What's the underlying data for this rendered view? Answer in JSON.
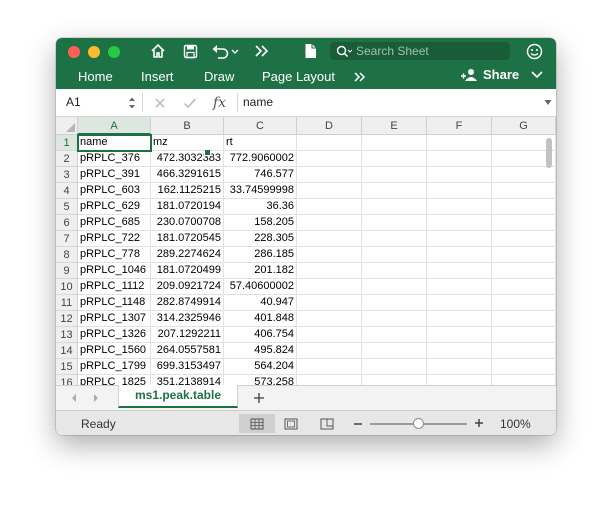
{
  "colors": {
    "ribbon": "#1e7145",
    "selection": "#1e7145"
  },
  "quick_access": {
    "icons": [
      "home-icon",
      "save-icon",
      "undo-icon",
      "more-icon",
      "document-icon"
    ]
  },
  "search": {
    "placeholder": "Search Sheet"
  },
  "ribbon_tabs": [
    "Home",
    "Insert",
    "Draw",
    "Page Layout"
  ],
  "share_label": "Share",
  "formula_bar": {
    "name_box": "A1",
    "fx_label": "fx",
    "content": "name"
  },
  "columns": [
    "A",
    "B",
    "C",
    "D",
    "E",
    "F",
    "G"
  ],
  "rows": [
    [
      "name",
      "mz",
      "rt"
    ],
    [
      "pRPLC_376",
      "472.3032383",
      "772.9060002"
    ],
    [
      "pRPLC_391",
      "466.3291615",
      "746.577"
    ],
    [
      "pRPLC_603",
      "162.1125215",
      "33.74599998"
    ],
    [
      "pRPLC_629",
      "181.0720194",
      "36.36"
    ],
    [
      "pRPLC_685",
      "230.0700708",
      "158.205"
    ],
    [
      "pRPLC_722",
      "181.0720545",
      "228.305"
    ],
    [
      "pRPLC_778",
      "289.2274624",
      "286.185"
    ],
    [
      "pRPLC_1046",
      "181.0720499",
      "201.182"
    ],
    [
      "pRPLC_1112",
      "209.0921724",
      "57.40600002"
    ],
    [
      "pRPLC_1148",
      "282.8749914",
      "40.947"
    ],
    [
      "pRPLC_1307",
      "314.2325946",
      "401.848"
    ],
    [
      "pRPLC_1326",
      "207.1292211",
      "406.754"
    ],
    [
      "pRPLC_1560",
      "264.0557581",
      "495.824"
    ],
    [
      "pRPLC_1799",
      "699.3153497",
      "564.204"
    ],
    [
      "pRPLC_1825",
      "351.2138914",
      "573.258"
    ]
  ],
  "sheet_tab": "ms1.peak.table",
  "status": "Ready",
  "zoom": "100%"
}
